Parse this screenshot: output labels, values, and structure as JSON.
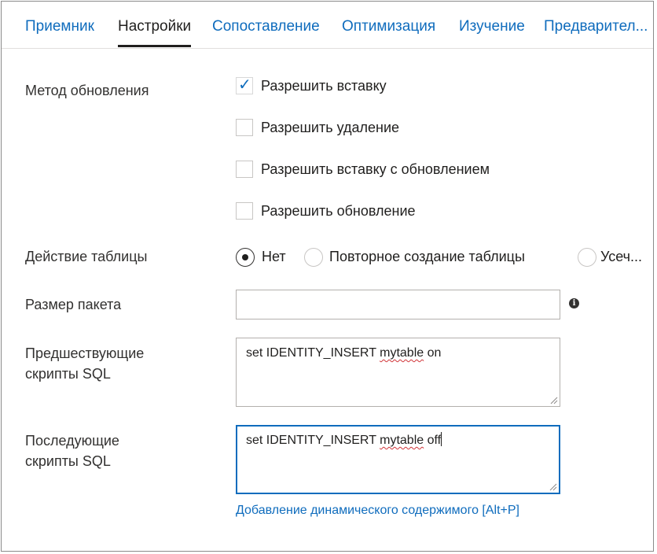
{
  "tabs": [
    {
      "label": "Приемник"
    },
    {
      "label": "Настройки"
    },
    {
      "label": "Сопоставление"
    },
    {
      "label": "Оптимизация"
    },
    {
      "label": "Изучение"
    },
    {
      "label": "Предварител..."
    }
  ],
  "active_tab": "Настройки",
  "update_method": {
    "label": "Метод обновления",
    "options": [
      {
        "label": "Разрешить вставку",
        "checked": true
      },
      {
        "label": "Разрешить удаление",
        "checked": false
      },
      {
        "label": "Разрешить вставку с обновлением",
        "checked": false
      },
      {
        "label": "Разрешить обновление",
        "checked": false
      }
    ]
  },
  "table_action": {
    "label": "Действие таблицы",
    "options": [
      {
        "label": "Нет",
        "selected": true
      },
      {
        "label": "Повторное создание таблицы",
        "selected": false
      },
      {
        "label": "Усеч...",
        "selected": false
      }
    ]
  },
  "batch_size": {
    "label": "Размер пакета",
    "value": "",
    "info_icon": "info-icon"
  },
  "pre_sql": {
    "label_line1": "Предшествующие",
    "label_line2": "скрипты SQL",
    "value_prefix": "set IDENTITY_INSERT ",
    "value_table": "mytable",
    "value_suffix": " on"
  },
  "post_sql": {
    "label_line1": "Последующие",
    "label_line2": "скрипты SQL",
    "value_prefix": "set IDENTITY_INSERT ",
    "value_table": "mytable",
    "value_suffix": " off"
  },
  "dynamic_content_link": "Добавление динамического содержимого [Alt+P]",
  "colors": {
    "accent": "#0f6cbd",
    "text": "#201f1e",
    "border": "#b3b0ad",
    "spellcheck": "#d13438"
  }
}
